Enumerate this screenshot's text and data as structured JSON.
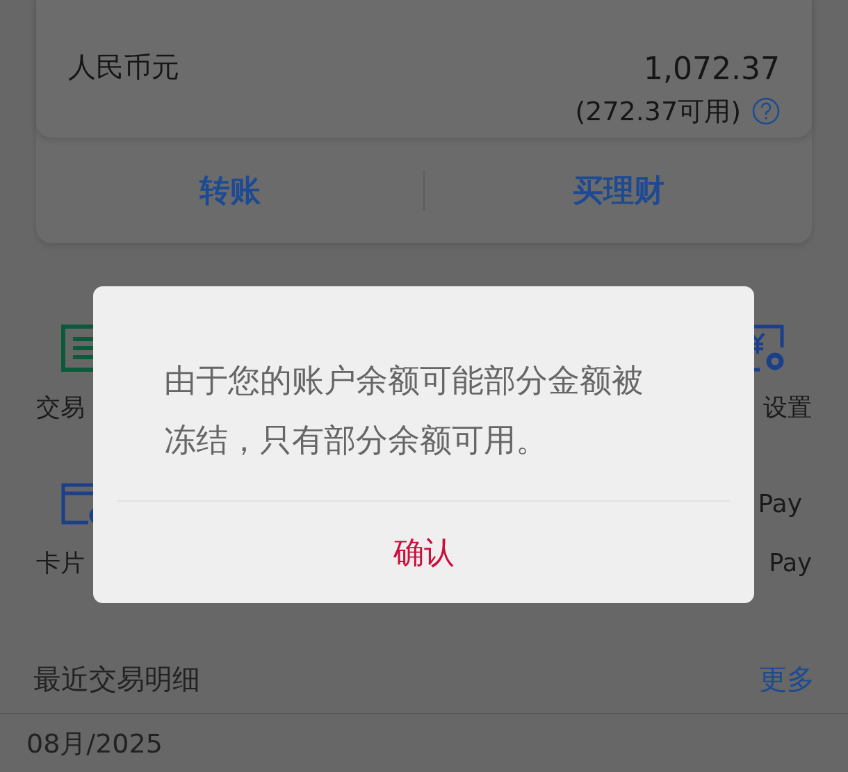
{
  "account": {
    "currency": "人民币元",
    "balance": "1,072.37",
    "available": "(272.37可用)"
  },
  "actions": [
    "转账",
    "买理财"
  ],
  "service_rows": [
    {
      "left": {
        "label": "交易",
        "kind": "list"
      },
      "right": {
        "label": "设置",
        "kind": "yen-gear"
      }
    },
    {
      "left": {
        "label": "卡片",
        "kind": "card-gear"
      },
      "right": {
        "label": "Pay",
        "kind": "mipay",
        "icon_text": "Pay"
      }
    }
  ],
  "recent": {
    "title": "最近交易明细",
    "more": "更多",
    "month": "08月/2025"
  },
  "dialog": {
    "message": "由于您的账户余额可能部分金额被冻结，只有部分余额可用。",
    "confirm": "确认"
  }
}
